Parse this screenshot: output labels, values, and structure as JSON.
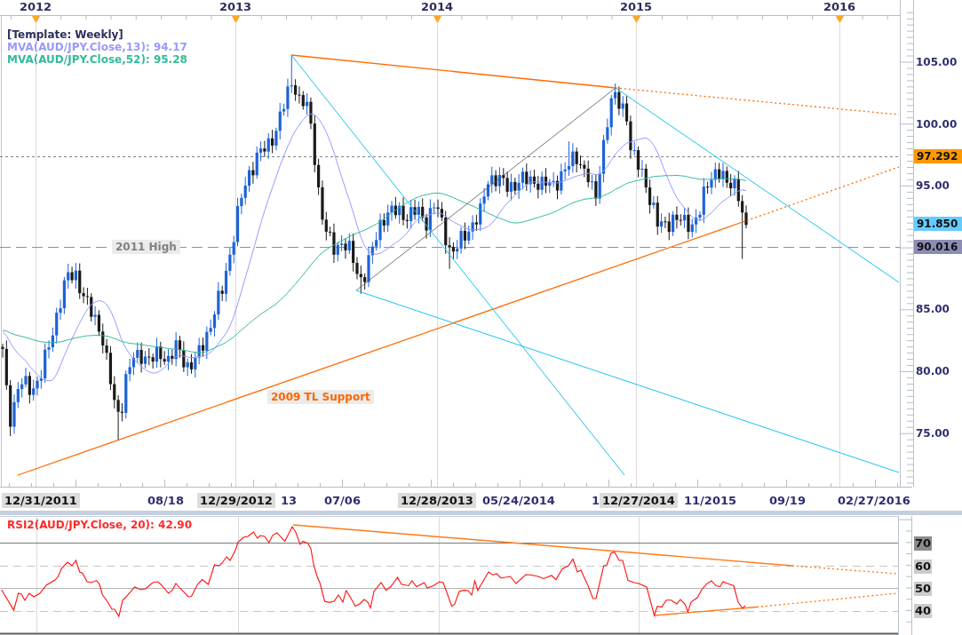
{
  "year_axis": {
    "labels": [
      "2012",
      "2013",
      "2014",
      "2015",
      "2016"
    ]
  },
  "legend": {
    "template": "[Template: Weekly]",
    "indicators": [
      {
        "label": "MVA(AUD/JPY.Close,13): 94.17",
        "color": "#9999ff"
      },
      {
        "label": "MVA(AUD/JPY.Close,52): 95.28",
        "color": "#33bb99"
      }
    ]
  },
  "price_axis": {
    "labels": [
      "105.00",
      "100.00",
      "95.00",
      "85.00",
      "80.00",
      "75.00"
    ],
    "markers": [
      {
        "label": "97.292",
        "color": "#ff9900"
      },
      {
        "label": "91.850",
        "color": "#66ccff"
      },
      {
        "label": "90.016",
        "color": "#8c8cb4"
      }
    ]
  },
  "annotations": [
    {
      "label": "2011 High",
      "color": "#808080"
    },
    {
      "label": "2009 TL Support",
      "color": "#ff6600"
    }
  ],
  "date_axis": {
    "labels": [
      {
        "label": "12/31/2011",
        "highlighted": true
      },
      {
        "label": "08/18",
        "highlighted": false
      },
      {
        "label": "12/29/2012",
        "highlighted": true
      },
      {
        "label": "13",
        "highlighted": false
      },
      {
        "label": "07/06",
        "highlighted": false
      },
      {
        "label": "12/28/2013",
        "highlighted": true
      },
      {
        "label": "05/24/2014",
        "highlighted": false
      },
      {
        "label": "1",
        "highlighted": false
      },
      {
        "label": "12/27/2014",
        "highlighted": true
      },
      {
        "label": "11/2015",
        "highlighted": false
      },
      {
        "label": "09/19",
        "highlighted": false
      },
      {
        "label": "02/27/2016",
        "highlighted": false
      }
    ]
  },
  "rsi_panel": {
    "title": "RSI2(AUD/JPY.Close, 20): 42.90",
    "axis_labels": [
      {
        "label": "70",
        "kind": "overbought"
      },
      {
        "label": "60",
        "kind": "guide"
      },
      {
        "label": "50",
        "kind": "midline"
      },
      {
        "label": "40",
        "kind": "guide"
      }
    ]
  }
}
